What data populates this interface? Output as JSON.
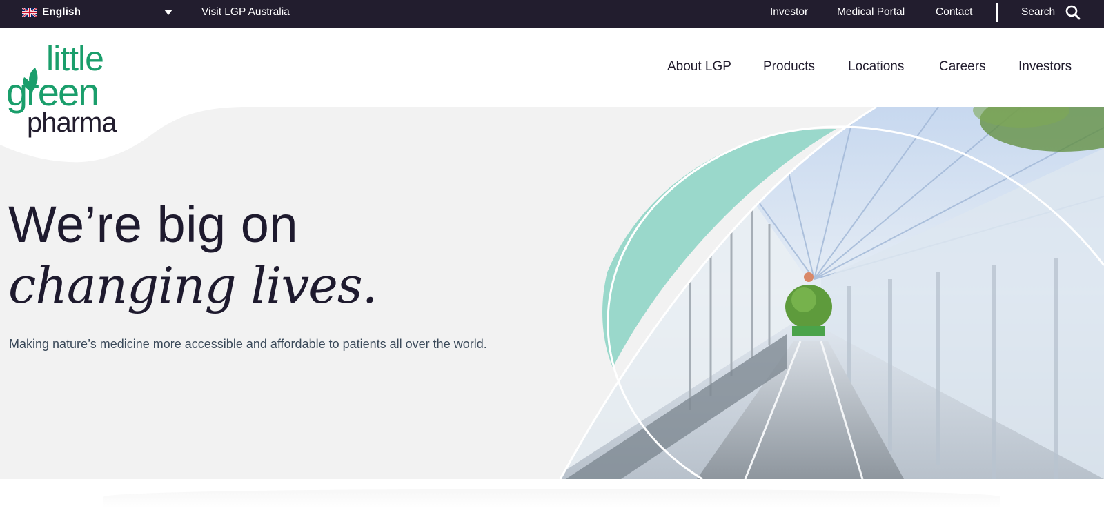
{
  "topbar": {
    "language": "English",
    "visit_link": "Visit LGP Australia",
    "links": [
      "Investor",
      "Medical Portal",
      "Contact"
    ],
    "search_label": "Search"
  },
  "brand": {
    "line1": "little",
    "line2": "green",
    "line3": "pharma",
    "brand_green": "#1a9e6b"
  },
  "nav": {
    "items": [
      "About LGP",
      "Products",
      "Locations",
      "Careers",
      "Investors"
    ]
  },
  "hero": {
    "title_line1": "We’re big on",
    "title_line2": "changing lives.",
    "subtitle": "Making nature’s medicine more accessible and affordable to patients all over the world.",
    "accent_color": "#9ad8cb"
  },
  "colors": {
    "topbar_bg": "#221d2e",
    "hero_bg": "#f2f2f2",
    "text_dark": "#1e1a2e"
  }
}
